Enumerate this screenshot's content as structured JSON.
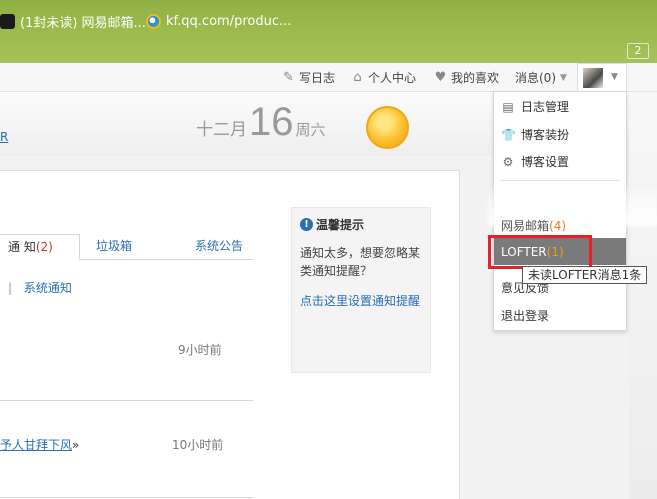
{
  "bookmarks": [
    {
      "label": "(1封未读) 网易邮箱...",
      "icon": "mail-favicon-icon"
    },
    {
      "label": "kf.qq.com/produc...",
      "icon": "qq-favicon-icon"
    }
  ],
  "tab_count": "2",
  "nav": {
    "write": "写日志",
    "center": "个人中心",
    "likes": "我的喜欢",
    "messages": "消息(0)"
  },
  "header": {
    "left_fragment": "R",
    "date_month": "十二月",
    "date_day": "16",
    "date_weekday": "周六"
  },
  "tabs": {
    "notice_label": "通 知",
    "notice_count": "(2)",
    "spam": "垃圾箱",
    "announce": "系统公告"
  },
  "subfilter": {
    "separator": "|",
    "label": "系统通知"
  },
  "notices": [
    {
      "time": "9小时前"
    },
    {
      "link_text": "予人甘拜下风",
      "suffix": "»",
      "time": "10小时前"
    }
  ],
  "tips": {
    "title": "温馨提示",
    "body": "通知太多，想要忽略某类通知提醒？",
    "link": "点击这里设置通知提醒"
  },
  "dropdown": {
    "logs": "日志管理",
    "decor": "博客装扮",
    "settings": "博客设置",
    "mail_label": "网易邮箱",
    "mail_count": "(4)",
    "lofter_label": "LOFTER",
    "lofter_count": "(1)",
    "feedback": "意见反馈",
    "logout": "退出登录"
  },
  "tooltip": "未读LOFTER消息1条",
  "colors": {
    "bookmark_bar": "#9bbb4d",
    "link_blue": "#2a6fb6",
    "highlight_red": "#e8202a",
    "lofter_bg": "#7a7a7a"
  }
}
